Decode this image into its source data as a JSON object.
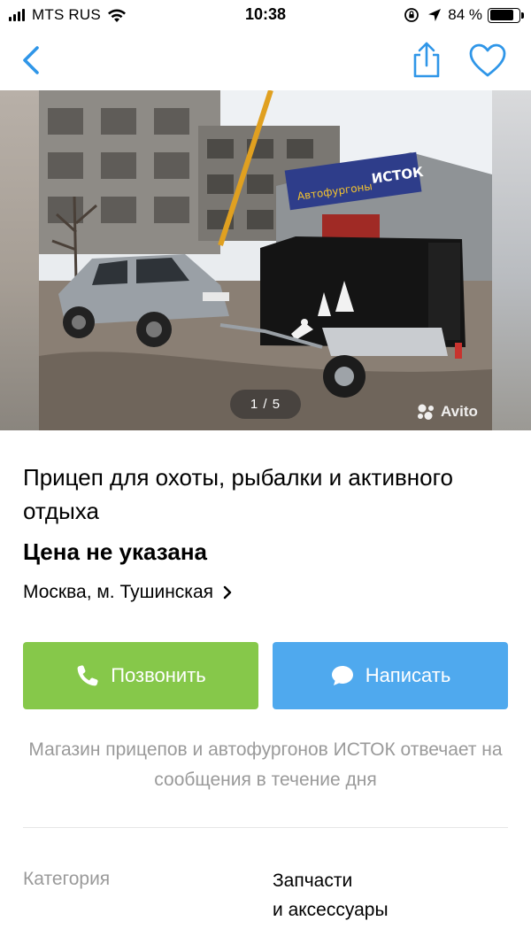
{
  "status_bar": {
    "carrier": "MTS RUS",
    "time": "10:38",
    "battery_percent": "84 %",
    "battery_level": 0.84,
    "icons": [
      "signal-bars-icon",
      "wifi-icon",
      "orientation-lock-icon",
      "location-arrow-icon",
      "battery-icon"
    ]
  },
  "nav": {
    "icons": [
      "back-chevron-icon",
      "share-icon",
      "heart-icon"
    ],
    "accent_color": "#2f96e8"
  },
  "gallery": {
    "counter": "1 / 5",
    "current": 1,
    "total": 5,
    "watermark": "Avito",
    "signage": "Автофургоны  ИСТОК"
  },
  "listing": {
    "title": "Прицеп для охоты, рыбалки и активного отдыха",
    "price": "Цена не указана",
    "location": "Москва, м. Тушинская"
  },
  "actions": {
    "call_label": "Позвонить",
    "call_color": "#86c84a",
    "write_label": "Написать",
    "write_color": "#4fa9ee"
  },
  "seller": {
    "note": "Магазин прицепов и автофургонов ИСТОК отвечает на сообщения в течение дня"
  },
  "params": {
    "category_label": "Категория",
    "category_value": "Запчасти\nи аксессуары"
  }
}
